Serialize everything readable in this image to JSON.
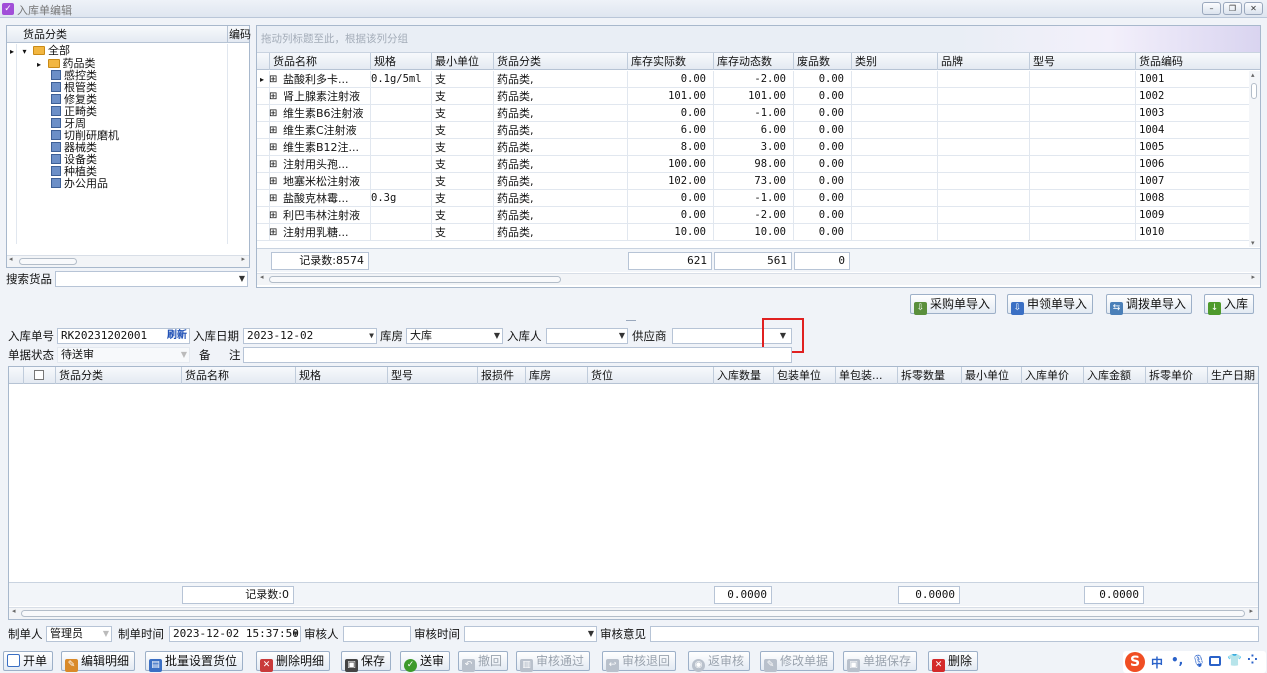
{
  "window": {
    "title": "入库单编辑",
    "controls": [
      "–",
      "❐",
      "✕"
    ]
  },
  "category_tree": {
    "header": "货品分类",
    "header2": "编码",
    "root": "全部",
    "items": [
      "药品类",
      "感控类",
      "根管类",
      "修复类",
      "正畸类",
      "牙周",
      "切削研磨机",
      "器械类",
      "设备类",
      "种植类",
      "办公用品"
    ]
  },
  "search": {
    "label": "搜索货品",
    "value": ""
  },
  "goods_grid": {
    "group_hint": "拖动列标题至此，根据该列分组",
    "columns": [
      "货品名称",
      "规格",
      "最小单位",
      "货品分类",
      "库存实际数",
      "库存动态数",
      "废品数",
      "类别",
      "品牌",
      "型号",
      "货品编码"
    ],
    "rows": [
      [
        "盐酸利多卡...",
        "0.1g/5ml",
        "支",
        "药品类,",
        "0.00",
        "-2.00",
        "0.00",
        "",
        "",
        "",
        "1001"
      ],
      [
        "肾上腺素注射液",
        "",
        "支",
        "药品类,",
        "101.00",
        "101.00",
        "0.00",
        "",
        "",
        "",
        "1002"
      ],
      [
        "维生素B6注射液",
        "",
        "支",
        "药品类,",
        "0.00",
        "-1.00",
        "0.00",
        "",
        "",
        "",
        "1003"
      ],
      [
        "维生素C注射液",
        "",
        "支",
        "药品类,",
        "6.00",
        "6.00",
        "0.00",
        "",
        "",
        "",
        "1004"
      ],
      [
        "维生素B12注...",
        "",
        "支",
        "药品类,",
        "8.00",
        "3.00",
        "0.00",
        "",
        "",
        "",
        "1005"
      ],
      [
        "注射用头孢...",
        "",
        "支",
        "药品类,",
        "100.00",
        "98.00",
        "0.00",
        "",
        "",
        "",
        "1006"
      ],
      [
        "地塞米松注射液",
        "",
        "支",
        "药品类,",
        "102.00",
        "73.00",
        "0.00",
        "",
        "",
        "",
        "1007"
      ],
      [
        "盐酸克林霉...",
        "0.3g",
        "支",
        "药品类,",
        "0.00",
        "-1.00",
        "0.00",
        "",
        "",
        "",
        "1008"
      ],
      [
        "利巴韦林注射液",
        "",
        "支",
        "药品类,",
        "0.00",
        "-2.00",
        "0.00",
        "",
        "",
        "",
        "1009"
      ],
      [
        "注射用乳糖...",
        "",
        "支",
        "药品类,",
        "10.00",
        "10.00",
        "0.00",
        "",
        "",
        "",
        "1010"
      ]
    ],
    "footer": {
      "record_count": "记录数:8574",
      "sum_actual": "621",
      "sum_dynamic": "561",
      "sum_waste": "0"
    }
  },
  "import_buttons": {
    "purchase": "采购单导入",
    "request": "申领单导入",
    "transfer": "调拨单导入",
    "stock_in": "入库"
  },
  "form": {
    "order_no_label": "入库单号",
    "order_no": "RK20231202001",
    "refresh": "刷新",
    "date_label": "入库日期",
    "date": "2023-12-02",
    "warehouse_label": "库房",
    "warehouse": "大库",
    "person_label": "入库人",
    "person": "",
    "supplier_label": "供应商",
    "supplier": "",
    "status_label": "单据状态",
    "status": "待送审",
    "remark_label_1": "备",
    "remark_label_2": "注",
    "remark": ""
  },
  "detail_grid": {
    "columns": [
      "货品分类",
      "货品名称",
      "规格",
      "型号",
      "报损件",
      "库房",
      "货位",
      "入库数量",
      "包装单位",
      "单包装...",
      "拆零数量",
      "最小单位",
      "入库单价",
      "入库金额",
      "拆零单价",
      "生产日期"
    ],
    "footer": {
      "record_count": "记录数:0",
      "qty_sum": "0.0000",
      "split_sum": "0.0000",
      "amount_sum": "0.0000"
    }
  },
  "bottom": {
    "maker_label": "制单人",
    "maker": "管理员",
    "make_time_label": "制单时间",
    "make_time": "2023-12-02 15:37:50",
    "auditor_label": "审核人",
    "auditor": "",
    "audit_time_label": "审核时间",
    "audit_time": "",
    "opinion_label": "审核意见",
    "opinion": ""
  },
  "actions": {
    "new": "开单",
    "edit_detail": "编辑明细",
    "batch_loc": "批量设置货位",
    "del_detail": "删除明细",
    "save": "保存",
    "submit": "送审",
    "withdraw": "撤回",
    "approve": "审核通过",
    "reject": "审核退回",
    "unapprove": "返审核",
    "modify": "修改单据",
    "doc_save": "单据保存",
    "delete": "删除"
  },
  "ime": {
    "logo": "S",
    "lang": "中",
    "symbols": "•,"
  },
  "colors": {
    "accent": "#3a6fc4",
    "highlight_box": "#e02020",
    "header_bg": "#e4eaf2"
  }
}
